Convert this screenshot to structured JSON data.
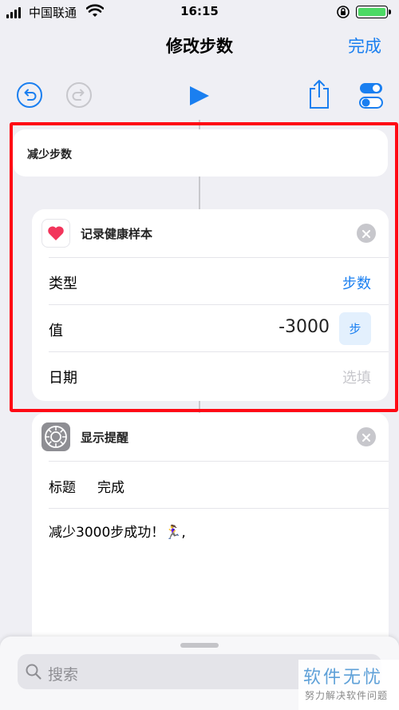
{
  "status_bar": {
    "carrier": "中国联通",
    "time": "16:15"
  },
  "nav": {
    "title": "修改步数",
    "done": "完成"
  },
  "toolbar": {
    "undo_icon": "undo-icon",
    "redo_icon": "redo-icon",
    "play_icon": "play-icon",
    "share_icon": "share-icon",
    "settings_icon": "toggle-settings-icon"
  },
  "workflow": {
    "name": "减少步数",
    "actions": [
      {
        "title": "记录健康样本",
        "icon": "heart-icon",
        "rows": [
          {
            "label": "类型",
            "value": "步数"
          },
          {
            "label": "值",
            "value": "-3000",
            "unit": "步"
          },
          {
            "label": "日期",
            "placeholder": "选填"
          }
        ]
      },
      {
        "title": "显示提醒",
        "icon": "gear-icon",
        "title_label": "标题",
        "title_value": "完成",
        "message": "减少3000步成功！🏃‍♀️,"
      }
    ]
  },
  "search": {
    "placeholder": "搜索"
  },
  "watermark": {
    "line1": "软件无忧",
    "line2": "努力解决软件问题"
  },
  "colors": {
    "accent": "#1a7ff0",
    "highlight": "#ff0a14",
    "heart": "#f2355b"
  }
}
